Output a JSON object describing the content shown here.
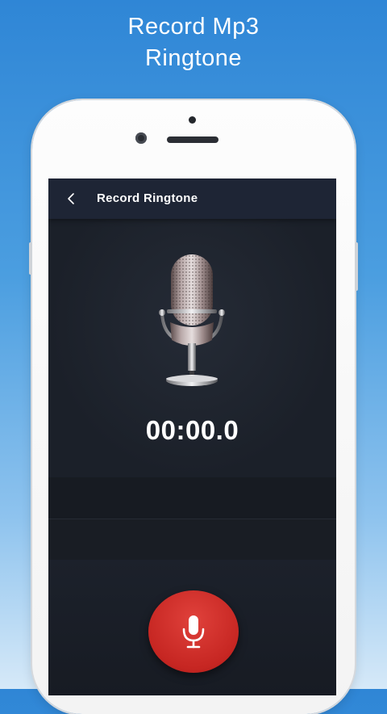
{
  "promo": {
    "title_line1": "Record Mp3",
    "title_line2": "Ringtone"
  },
  "app_bar": {
    "title": "Record Ringtone",
    "back_icon": "chevron-left-icon"
  },
  "recorder": {
    "timer": "00:00.0",
    "mic_image": "vintage-microphone",
    "record_button_icon": "microphone-icon"
  },
  "colors": {
    "background_top": "#2f86d6",
    "screen_bg": "#1b2230",
    "app_bar_bg": "#1e2535",
    "record_button": "#c62622",
    "text": "#ffffff"
  }
}
